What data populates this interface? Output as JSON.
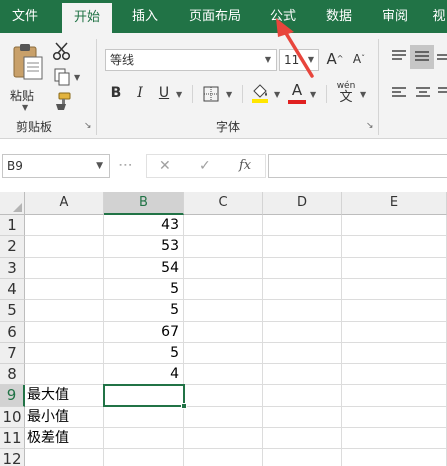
{
  "tabs": [
    {
      "label": "文件",
      "active": false
    },
    {
      "label": "开始",
      "active": true
    },
    {
      "label": "插入",
      "active": false
    },
    {
      "label": "页面布局",
      "active": false
    },
    {
      "label": "公式",
      "active": false
    },
    {
      "label": "数据",
      "active": false
    },
    {
      "label": "审阅",
      "active": false
    },
    {
      "label": "视",
      "active": false
    }
  ],
  "ribbon": {
    "clipboard": {
      "paste_label": "粘贴",
      "group_label": "剪贴板",
      "launcher": "↘"
    },
    "font": {
      "font_name": "等线",
      "font_size": "11",
      "grow_glyph": "A",
      "shrink_glyph": "A",
      "bold": "B",
      "italic": "I",
      "underline": "U",
      "font_color_glyph": "A",
      "phonetic_top": "wén",
      "phonetic_bottom": "文",
      "group_label": "字体",
      "launcher": "↘"
    }
  },
  "formula_bar": {
    "name_box": "B9",
    "name_dropdown": "▼",
    "cancel_glyph": "✕",
    "enter_glyph": "✓",
    "fx_glyph": "fx",
    "formula": ""
  },
  "sheet": {
    "columns": [
      "A",
      "B",
      "C",
      "D",
      "E"
    ],
    "selected_column": "B",
    "rows": [
      {
        "num": "1",
        "A": "",
        "B": "43"
      },
      {
        "num": "2",
        "A": "",
        "B": "53"
      },
      {
        "num": "3",
        "A": "",
        "B": "54"
      },
      {
        "num": "4",
        "A": "",
        "B": "5"
      },
      {
        "num": "5",
        "A": "",
        "B": "5"
      },
      {
        "num": "6",
        "A": "",
        "B": "67"
      },
      {
        "num": "7",
        "A": "",
        "B": "5"
      },
      {
        "num": "8",
        "A": "",
        "B": "4"
      },
      {
        "num": "9",
        "A": "最大值",
        "B": ""
      },
      {
        "num": "10",
        "A": "最小值",
        "B": ""
      },
      {
        "num": "11",
        "A": "极差值",
        "B": ""
      },
      {
        "num": "12",
        "A": "",
        "B": ""
      }
    ],
    "selected_row": "9",
    "selected_cell": "B9"
  },
  "colors": {
    "accent": "#217346",
    "annotation_arrow": "#e8453c"
  }
}
